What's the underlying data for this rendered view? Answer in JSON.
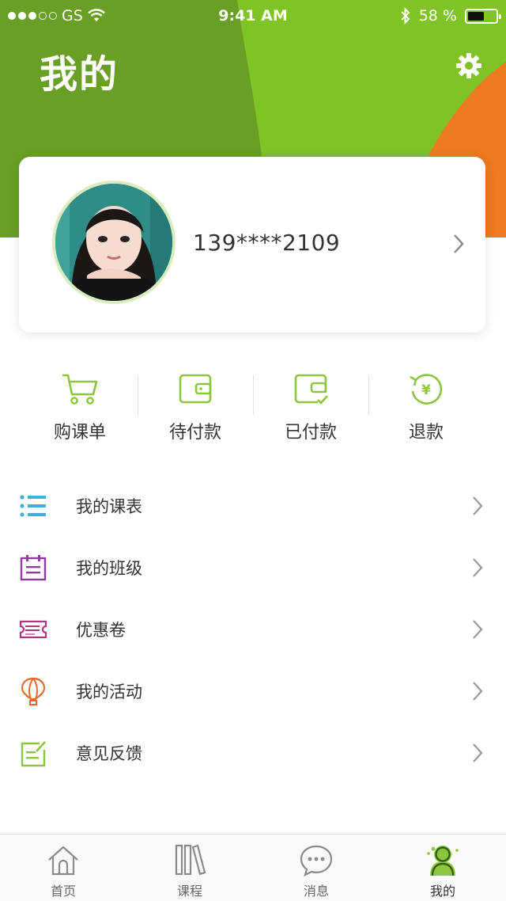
{
  "status_bar": {
    "carrier": "GS",
    "time": "9:41 AM",
    "battery": "58 %"
  },
  "header": {
    "title": "我的",
    "settings_icon": "gear-icon"
  },
  "profile": {
    "phone": "139****2109"
  },
  "orders": [
    {
      "label": "购课单",
      "icon": "cart-icon"
    },
    {
      "label": "待付款",
      "icon": "wallet-icon"
    },
    {
      "label": "已付款",
      "icon": "wallet-check-icon"
    },
    {
      "label": "退款",
      "icon": "refund-yen-icon"
    }
  ],
  "menu": [
    {
      "label": "我的课表",
      "icon": "list-icon"
    },
    {
      "label": "我的班级",
      "icon": "calendar-icon"
    },
    {
      "label": "优惠卷",
      "icon": "ticket-icon"
    },
    {
      "label": "我的活动",
      "icon": "balloon-icon"
    },
    {
      "label": "意见反馈",
      "icon": "feedback-icon"
    }
  ],
  "tabs": [
    {
      "label": "首页",
      "icon": "home-icon"
    },
    {
      "label": "课程",
      "icon": "books-icon"
    },
    {
      "label": "消息",
      "icon": "message-icon"
    },
    {
      "label": "我的",
      "icon": "user-icon",
      "active": true
    }
  ],
  "colors": {
    "green_dark": "#6a9f26",
    "green_light": "#7fc326",
    "orange": "#ee7a22",
    "accent_green": "#8cc63f",
    "list_blue": "#3bb2d6",
    "calendar_purple": "#8e3f9e",
    "ticket_magenta": "#b0357e",
    "balloon_orange": "#e8692c"
  }
}
